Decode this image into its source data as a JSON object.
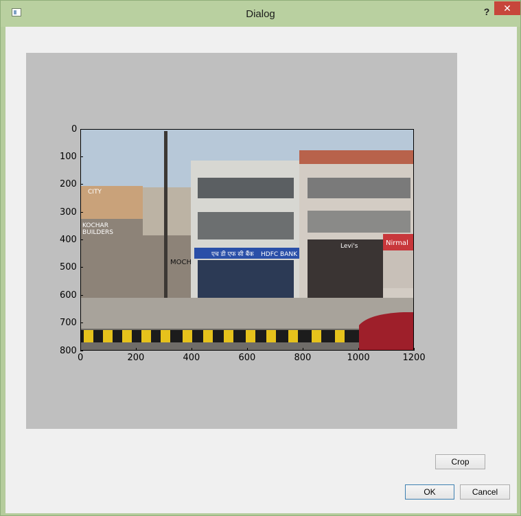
{
  "window": {
    "title": "Dialog",
    "help_label": "?",
    "close_label": "✕"
  },
  "chart_data": {
    "type": "image",
    "xticks": [
      "0",
      "200",
      "400",
      "600",
      "800",
      "1000",
      "1200"
    ],
    "yticks": [
      "0",
      "100",
      "200",
      "300",
      "400",
      "500",
      "600",
      "700",
      "800"
    ],
    "xlim": [
      0,
      1200
    ],
    "ylim": [
      800,
      0
    ]
  },
  "photo_signs": {
    "city": "CITY",
    "kochar": "KOCHAR",
    "builders": "BUILDERS",
    "hdfc_hindi": "एच डी एफ सी बैंक",
    "hdfc": "HDFC BANK",
    "levis": "Levi's",
    "nirmal": "Nirmal",
    "moch": "MOCH"
  },
  "buttons": {
    "crop": "Crop",
    "ok": "OK",
    "cancel": "Cancel"
  },
  "colors": {
    "titlebar": "#b9d0a0",
    "close": "#c7463b",
    "canvas": "#bfbfbf",
    "dialog": "#f0f0f0"
  }
}
